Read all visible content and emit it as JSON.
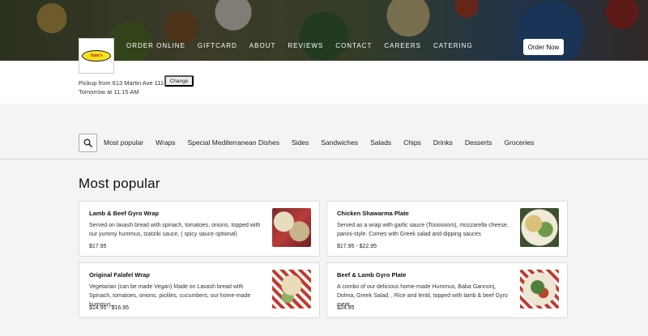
{
  "header": {
    "logo_text": "Sam's",
    "nav": [
      "ORDER ONLINE",
      "GIFTCARD",
      "ABOUT",
      "REVIEWS",
      "CONTACT",
      "CAREERS",
      "CATERING"
    ],
    "order_now_label": "Order Now"
  },
  "pickup": {
    "location": "Pickup from 613 Martin Ave 111",
    "time": "Tomorrow at 11:15 AM",
    "change_label": "Change"
  },
  "categories": [
    "Most popular",
    "Wraps",
    "Special Mediterranean Dishes",
    "Sides",
    "Sandwiches",
    "Salads",
    "Chips",
    "Drinks",
    "Desserts",
    "Groceries"
  ],
  "section": {
    "title": "Most popular"
  },
  "items": [
    {
      "name": "Lamb & Beef Gyro Wrap",
      "desc": "Served on lavash bread with spinach, tomatoes, onions, topped with our yummy hummus, tzatziki sauce, ( spicy sauce optional)",
      "price": "$17.95"
    },
    {
      "name": "Chicken Shawarma Plate",
      "desc": "Served as a wrap with garlic sauce (Toooooom), mozzarella cheese, panini-style. Comes with Greek salad and dipping sauces",
      "price": "$17.95 - $22.95"
    },
    {
      "name": "Original Falafel Wrap",
      "desc": "Vegetarian (can be made Vegan) Made on Lavash bread with Spinach, tomatoes, onions, pickles, cucumbers, our home-made hummus,...",
      "price": "$14.95 - $16.95"
    },
    {
      "name": "Beef & Lamb Gyro Plate",
      "desc": "A combo of our delicious home-made Hummus, Baba Gannonj, Dolma, Greek Salad, , Rice and lentil, topped with lamb & beef Gyro meat...",
      "price": "$24.95"
    }
  ],
  "icons": {
    "search": "search-icon",
    "logo": "restaurant-logo"
  }
}
